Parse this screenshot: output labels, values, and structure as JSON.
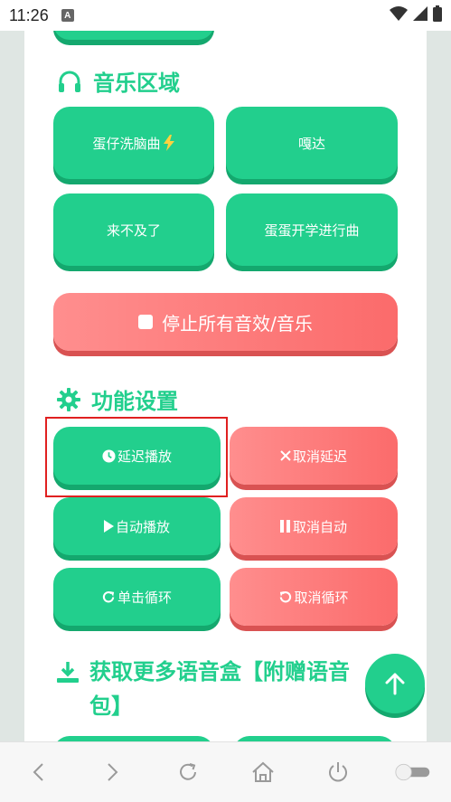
{
  "status_bar": {
    "time": "11:26",
    "notification_letter": "A"
  },
  "sections": {
    "music": {
      "title": "音乐区域"
    },
    "settings": {
      "title": "功能设置"
    },
    "more": {
      "title": "获取更多语音盒【附赠语音包】"
    }
  },
  "music_buttons": {
    "egg_brainwash": "蛋仔洗脑曲",
    "gada": "嘎达",
    "too_late": "来不及了",
    "egg_school_march": "蛋蛋开学进行曲"
  },
  "stop_all_button": "停止所有音效/音乐",
  "settings_buttons": {
    "delay_play": "延迟播放",
    "cancel_delay": "取消延迟",
    "auto_play": "自动播放",
    "cancel_auto": "取消自动",
    "single_loop": "单击循环",
    "cancel_loop": "取消循环"
  },
  "colors": {
    "accent_green": "#22cf8d",
    "accent_green_shadow": "#14a86e",
    "danger_red": "#fb6b6b",
    "highlight_red": "#e02020"
  }
}
